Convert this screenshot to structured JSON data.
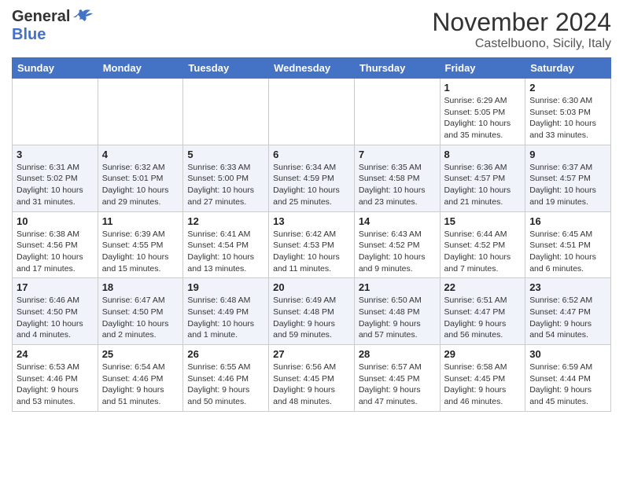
{
  "header": {
    "logo": {
      "line1": "General",
      "line2": "Blue",
      "tagline": ""
    },
    "title": "November 2024",
    "location": "Castelbuono, Sicily, Italy"
  },
  "calendar": {
    "days_of_week": [
      "Sunday",
      "Monday",
      "Tuesday",
      "Wednesday",
      "Thursday",
      "Friday",
      "Saturday"
    ],
    "weeks": [
      [
        {
          "day": "",
          "info": ""
        },
        {
          "day": "",
          "info": ""
        },
        {
          "day": "",
          "info": ""
        },
        {
          "day": "",
          "info": ""
        },
        {
          "day": "",
          "info": ""
        },
        {
          "day": "1",
          "info": "Sunrise: 6:29 AM\nSunset: 5:05 PM\nDaylight: 10 hours\nand 35 minutes."
        },
        {
          "day": "2",
          "info": "Sunrise: 6:30 AM\nSunset: 5:03 PM\nDaylight: 10 hours\nand 33 minutes."
        }
      ],
      [
        {
          "day": "3",
          "info": "Sunrise: 6:31 AM\nSunset: 5:02 PM\nDaylight: 10 hours\nand 31 minutes."
        },
        {
          "day": "4",
          "info": "Sunrise: 6:32 AM\nSunset: 5:01 PM\nDaylight: 10 hours\nand 29 minutes."
        },
        {
          "day": "5",
          "info": "Sunrise: 6:33 AM\nSunset: 5:00 PM\nDaylight: 10 hours\nand 27 minutes."
        },
        {
          "day": "6",
          "info": "Sunrise: 6:34 AM\nSunset: 4:59 PM\nDaylight: 10 hours\nand 25 minutes."
        },
        {
          "day": "7",
          "info": "Sunrise: 6:35 AM\nSunset: 4:58 PM\nDaylight: 10 hours\nand 23 minutes."
        },
        {
          "day": "8",
          "info": "Sunrise: 6:36 AM\nSunset: 4:57 PM\nDaylight: 10 hours\nand 21 minutes."
        },
        {
          "day": "9",
          "info": "Sunrise: 6:37 AM\nSunset: 4:57 PM\nDaylight: 10 hours\nand 19 minutes."
        }
      ],
      [
        {
          "day": "10",
          "info": "Sunrise: 6:38 AM\nSunset: 4:56 PM\nDaylight: 10 hours\nand 17 minutes."
        },
        {
          "day": "11",
          "info": "Sunrise: 6:39 AM\nSunset: 4:55 PM\nDaylight: 10 hours\nand 15 minutes."
        },
        {
          "day": "12",
          "info": "Sunrise: 6:41 AM\nSunset: 4:54 PM\nDaylight: 10 hours\nand 13 minutes."
        },
        {
          "day": "13",
          "info": "Sunrise: 6:42 AM\nSunset: 4:53 PM\nDaylight: 10 hours\nand 11 minutes."
        },
        {
          "day": "14",
          "info": "Sunrise: 6:43 AM\nSunset: 4:52 PM\nDaylight: 10 hours\nand 9 minutes."
        },
        {
          "day": "15",
          "info": "Sunrise: 6:44 AM\nSunset: 4:52 PM\nDaylight: 10 hours\nand 7 minutes."
        },
        {
          "day": "16",
          "info": "Sunrise: 6:45 AM\nSunset: 4:51 PM\nDaylight: 10 hours\nand 6 minutes."
        }
      ],
      [
        {
          "day": "17",
          "info": "Sunrise: 6:46 AM\nSunset: 4:50 PM\nDaylight: 10 hours\nand 4 minutes."
        },
        {
          "day": "18",
          "info": "Sunrise: 6:47 AM\nSunset: 4:50 PM\nDaylight: 10 hours\nand 2 minutes."
        },
        {
          "day": "19",
          "info": "Sunrise: 6:48 AM\nSunset: 4:49 PM\nDaylight: 10 hours\nand 1 minute."
        },
        {
          "day": "20",
          "info": "Sunrise: 6:49 AM\nSunset: 4:48 PM\nDaylight: 9 hours\nand 59 minutes."
        },
        {
          "day": "21",
          "info": "Sunrise: 6:50 AM\nSunset: 4:48 PM\nDaylight: 9 hours\nand 57 minutes."
        },
        {
          "day": "22",
          "info": "Sunrise: 6:51 AM\nSunset: 4:47 PM\nDaylight: 9 hours\nand 56 minutes."
        },
        {
          "day": "23",
          "info": "Sunrise: 6:52 AM\nSunset: 4:47 PM\nDaylight: 9 hours\nand 54 minutes."
        }
      ],
      [
        {
          "day": "24",
          "info": "Sunrise: 6:53 AM\nSunset: 4:46 PM\nDaylight: 9 hours\nand 53 minutes."
        },
        {
          "day": "25",
          "info": "Sunrise: 6:54 AM\nSunset: 4:46 PM\nDaylight: 9 hours\nand 51 minutes."
        },
        {
          "day": "26",
          "info": "Sunrise: 6:55 AM\nSunset: 4:46 PM\nDaylight: 9 hours\nand 50 minutes."
        },
        {
          "day": "27",
          "info": "Sunrise: 6:56 AM\nSunset: 4:45 PM\nDaylight: 9 hours\nand 48 minutes."
        },
        {
          "day": "28",
          "info": "Sunrise: 6:57 AM\nSunset: 4:45 PM\nDaylight: 9 hours\nand 47 minutes."
        },
        {
          "day": "29",
          "info": "Sunrise: 6:58 AM\nSunset: 4:45 PM\nDaylight: 9 hours\nand 46 minutes."
        },
        {
          "day": "30",
          "info": "Sunrise: 6:59 AM\nSunset: 4:44 PM\nDaylight: 9 hours\nand 45 minutes."
        }
      ]
    ]
  }
}
